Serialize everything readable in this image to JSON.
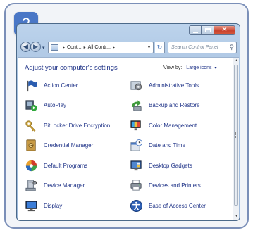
{
  "step_badge": "2",
  "window": {
    "address": {
      "crumbs": [
        "Cont...",
        "All Contr..."
      ],
      "separator": "▸",
      "dropdown_glyph": "▾"
    },
    "refresh_glyph": "↻",
    "search": {
      "placeholder": "Search Control Panel",
      "icon": "search-icon"
    },
    "nav": {
      "back_glyph": "◀",
      "forward_glyph": "▶",
      "history_glyph": "▾"
    },
    "caption_buttons": {
      "close_glyph": "✕"
    }
  },
  "panel": {
    "title": "Adjust your computer's settings",
    "view_by_label": "View by:",
    "view_by_value": "Large icons",
    "view_by_caret": "▾"
  },
  "scrollbar": {
    "up_glyph": "▲",
    "down_glyph": "▼"
  },
  "items": [
    {
      "label": "Action Center",
      "icon": "flag-icon"
    },
    {
      "label": "Administrative Tools",
      "icon": "admin-tools-icon"
    },
    {
      "label": "AutoPlay",
      "icon": "autoplay-icon"
    },
    {
      "label": "Backup and Restore",
      "icon": "backup-icon"
    },
    {
      "label": "BitLocker Drive Encryption",
      "icon": "key-icon"
    },
    {
      "label": "Color Management",
      "icon": "color-management-icon"
    },
    {
      "label": "Credential Manager",
      "icon": "vault-icon"
    },
    {
      "label": "Date and Time",
      "icon": "clock-icon"
    },
    {
      "label": "Default Programs",
      "icon": "default-programs-icon"
    },
    {
      "label": "Desktop Gadgets",
      "icon": "gadgets-icon"
    },
    {
      "label": "Device Manager",
      "icon": "device-manager-icon"
    },
    {
      "label": "Devices and Printers",
      "icon": "printer-icon"
    },
    {
      "label": "Display",
      "icon": "monitor-icon"
    },
    {
      "label": "Ease of Access Center",
      "icon": "ease-of-access-icon"
    }
  ],
  "colors": {
    "link": "#1e3287",
    "badge": "#4a77c6",
    "frame_border": "#7b8fb8",
    "window_chrome": "#a8c2e0",
    "close_button": "#c8412d"
  }
}
